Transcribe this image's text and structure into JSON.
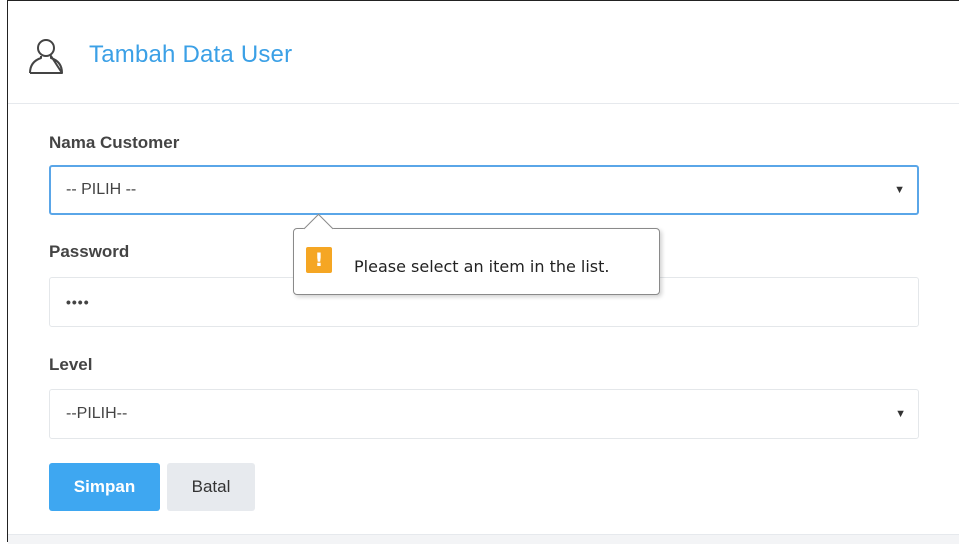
{
  "header": {
    "title": "Tambah Data User",
    "icon": "user-outline-icon"
  },
  "form": {
    "customer": {
      "label": "Nama Customer",
      "selected": "-- PILIH --"
    },
    "password": {
      "label": "Password",
      "value": "••••"
    },
    "level": {
      "label": "Level",
      "selected": "--PILIH--"
    }
  },
  "validation": {
    "message": "Please select an item in the list.",
    "icon": "warning-icon"
  },
  "buttons": {
    "save": "Simpan",
    "cancel": "Batal"
  },
  "colors": {
    "accent": "#3ba0e6",
    "primary_button": "#3ea7f1",
    "warning": "#f5a623"
  }
}
